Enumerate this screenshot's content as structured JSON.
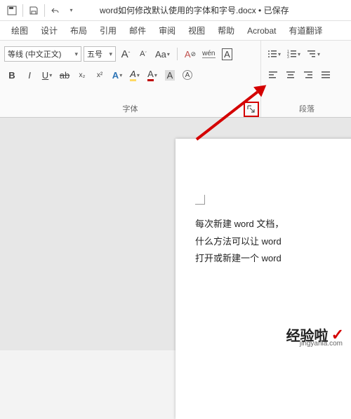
{
  "title": {
    "filename": "word如何修改默认使用的字体和字号.docx",
    "status": "已保存",
    "sep": " • "
  },
  "menu": [
    "绘图",
    "设计",
    "布局",
    "引用",
    "邮件",
    "审阅",
    "视图",
    "帮助",
    "Acrobat",
    "有道翻译"
  ],
  "font_group": {
    "label": "字体",
    "font_name": "等线 (中文正文)",
    "font_size": "五号",
    "buttons": {
      "grow": "A",
      "shrink": "A",
      "aa_case": "Aa",
      "clear": "A",
      "phonetic": "wén",
      "charborder": "A",
      "bold": "B",
      "italic": "I",
      "underline": "U",
      "strike": "ab",
      "sub": "x₂",
      "sup": "x²",
      "textfx": "A",
      "highlight": "A",
      "fontcolor": "A",
      "shade": "A",
      "enclosed": "A"
    }
  },
  "para_group": {
    "label": "段落"
  },
  "document": {
    "lines": [
      "每次新建 word 文档，",
      "什么方法可以让 word",
      "打开或新建一个 word"
    ]
  },
  "watermark": {
    "main": "经验啦",
    "sub": "jingyanla.com"
  }
}
